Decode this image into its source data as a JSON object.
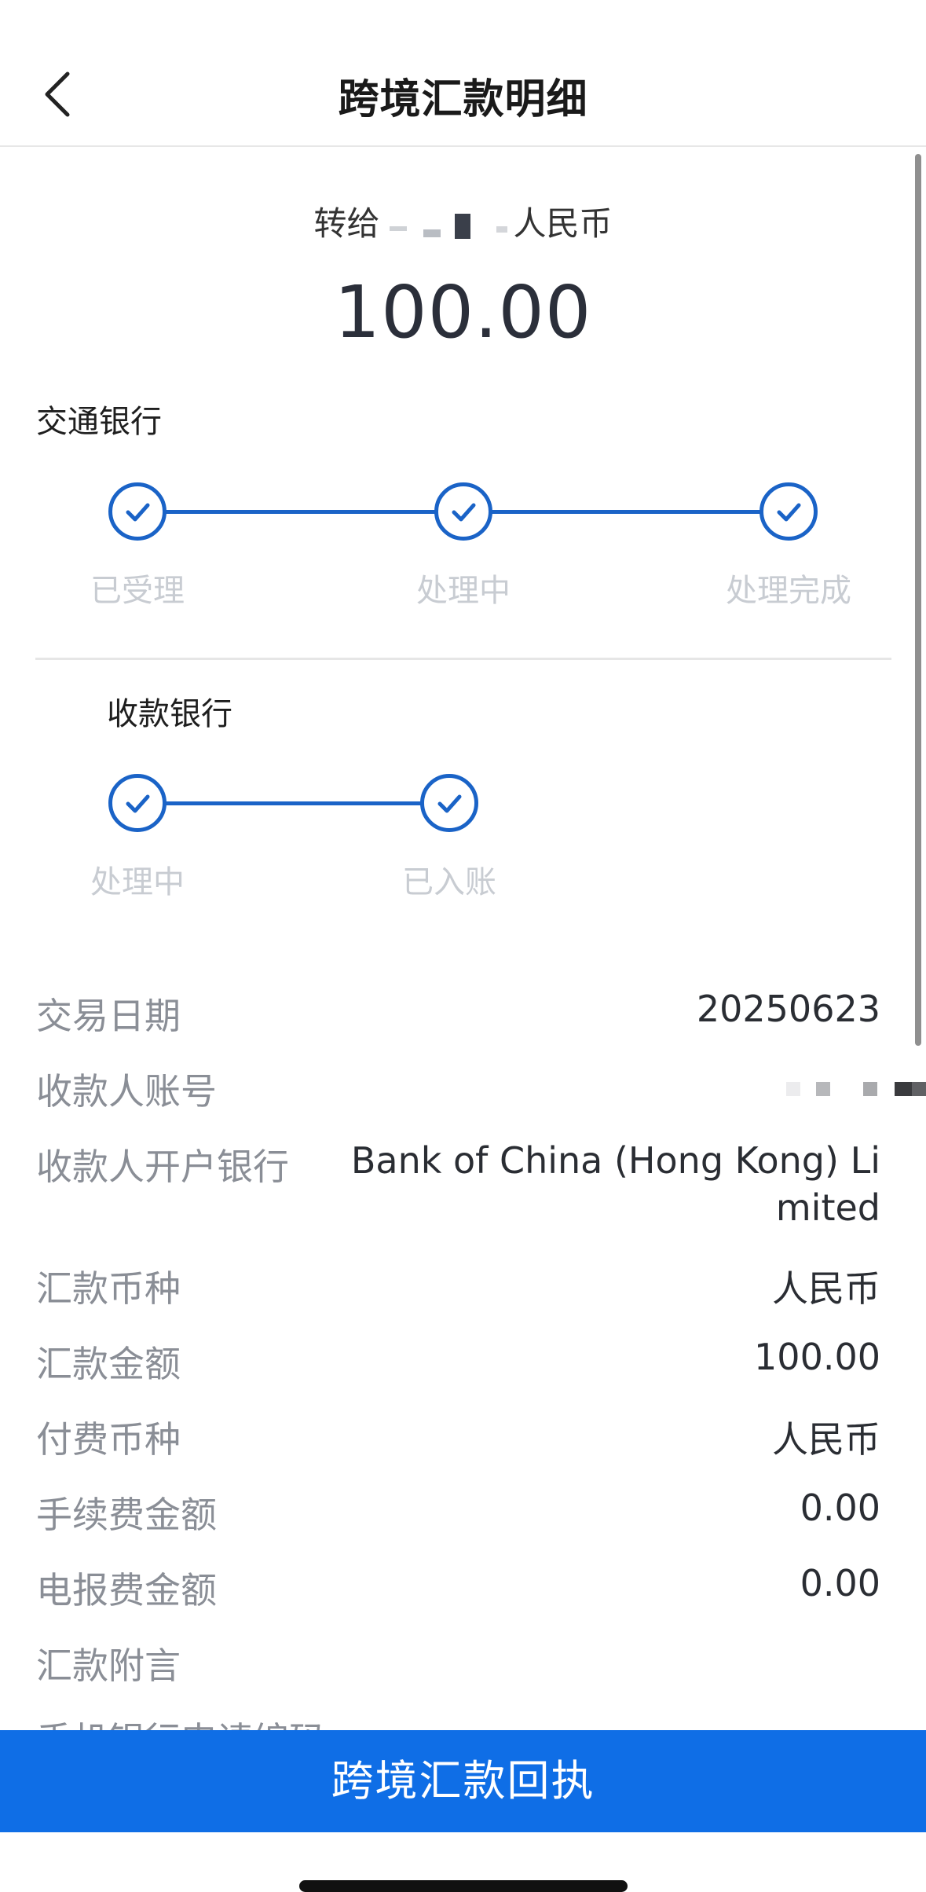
{
  "header": {
    "title": "跨境汇款明细"
  },
  "summary": {
    "recipient_prefix": "转给",
    "recipient_suffix": "人民币",
    "amount": "100.00"
  },
  "payer_bank": {
    "name": "交通银行",
    "steps": [
      "已受理",
      "处理中",
      "处理完成"
    ]
  },
  "payee_bank": {
    "name": "收款银行",
    "steps": [
      "处理中",
      "已入账"
    ]
  },
  "details": {
    "date_label": "交易日期",
    "date_value": "20250623",
    "account_label": "收款人账号",
    "bank_label": "收款人开户银行",
    "bank_value_line1": "Bank of China (Hong Kong) Li",
    "bank_value_line2": "mited",
    "currency_label": "汇款币种",
    "currency_value": "人民币",
    "amount_label": "汇款金额",
    "amount_value": "100.00",
    "fee_currency_label": "付费币种",
    "fee_currency_value": "人民币",
    "service_fee_label": "手续费金额",
    "service_fee_value": "0.00",
    "telegraph_fee_label": "电报费金额",
    "telegraph_fee_value": "0.00",
    "remark_label": "汇款附言",
    "app_code_label": "手机银行申请编码"
  },
  "bottom_button": {
    "label": "跨境汇款回执"
  },
  "colors": {
    "accent": "#1a63c7",
    "button": "#0f6ee6",
    "label": "#8a8e96",
    "step_label": "#c8ccd2"
  }
}
